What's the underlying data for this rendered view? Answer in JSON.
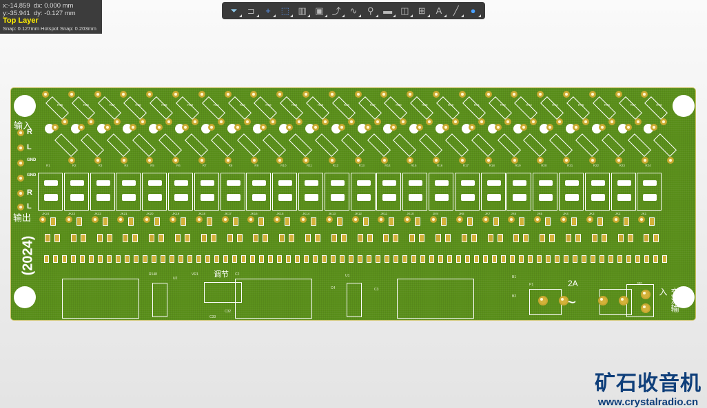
{
  "info": {
    "x": "x:-14.859",
    "dx": "dx:  0.000 mm",
    "y": "y:-35.941",
    "dy": "dy: -0.127 mm",
    "layer": "Top Layer",
    "snap": "Snap: 0.127mm Hotspot Snap: 0.203mm"
  },
  "toolbar": [
    "filter-icon",
    "interactive-route-icon",
    "cross-icon",
    "select-rect-icon",
    "align-icon",
    "component-icon",
    "route-icon",
    "diff-pair-icon",
    "via-icon",
    "polygon-icon",
    "keepout-icon",
    "dimension-icon",
    "string-icon",
    "line-icon",
    "3d-view-icon"
  ],
  "board": {
    "left_labels": {
      "input": "输入",
      "output": "输出",
      "r1": "R",
      "l1": "L",
      "gnd1": "GND",
      "gnd2": "GND",
      "r2": "R",
      "l2": "L",
      "year": "(2024)"
    },
    "top_res": [
      "R25",
      "R26",
      "R27",
      "R28",
      "R29",
      "R30",
      "R31",
      "R32",
      "R33",
      "R34",
      "R35",
      "R36",
      "R37",
      "R38",
      "R39",
      "R40",
      "R41",
      "R42",
      "R43",
      "R44",
      "R45",
      "R46",
      "R47",
      "R48"
    ],
    "bot_res": [
      "R1",
      "R2",
      "R3",
      "R4",
      "R5",
      "R6",
      "R7",
      "R8",
      "R9",
      "R10",
      "R11",
      "R12",
      "R13",
      "R14",
      "R15",
      "R16",
      "R17",
      "R18",
      "R19",
      "R20",
      "R21",
      "R22",
      "R23",
      "R24"
    ],
    "jacks": [
      "JK24",
      "JK23",
      "JK22",
      "JK21",
      "JK20",
      "JK19",
      "JK18",
      "JK17",
      "JK16",
      "JK15",
      "JK14",
      "JK13",
      "JK12",
      "JK11",
      "JK10",
      "JK9",
      "JK8",
      "JK7",
      "JK6",
      "JK5",
      "JK4",
      "JK3",
      "JK2",
      "JK1"
    ],
    "bottom": {
      "adjust": "调节",
      "vr": "VR1",
      "u2": "U2",
      "u1": "U1",
      "c2": "C2",
      "c3": "C3",
      "c4": "C4",
      "r148": "R148",
      "fuse": "2A",
      "ac_in": "交流输入",
      "p1": "P1",
      "jp1": "JP1",
      "b1": "B1",
      "b2": "B2",
      "c32": "C32",
      "c33": "C33"
    }
  },
  "watermark": {
    "name": "矿石收音机",
    "url": "www.crystalradio.cn"
  }
}
